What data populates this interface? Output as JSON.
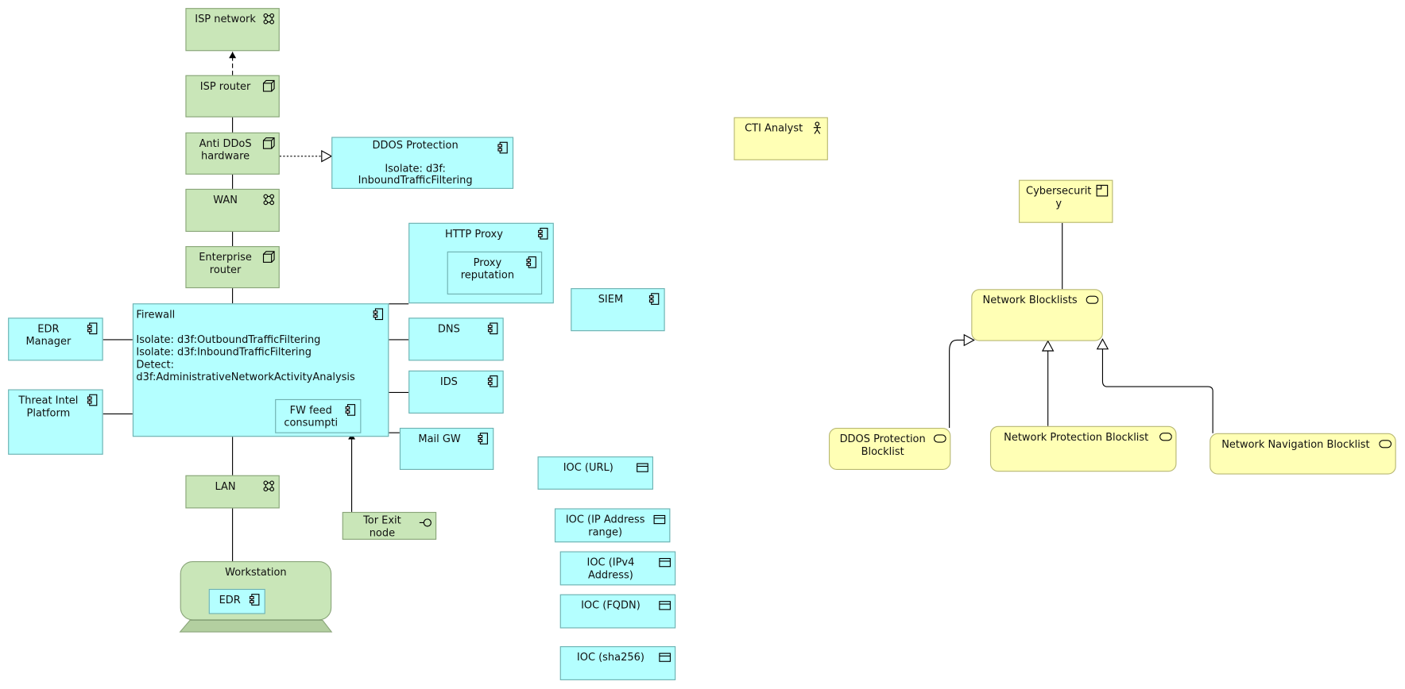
{
  "colors": {
    "technology": "#c9e6b8",
    "application": "#b4ffff",
    "business": "#ffffb5"
  },
  "nodes": {
    "isp_network": {
      "label": "ISP network",
      "icon": "network-icon"
    },
    "isp_router": {
      "label": "ISP router",
      "icon": "device-icon"
    },
    "anti_ddos": {
      "label": "Anti DDoS\nhardware",
      "icon": "device-icon"
    },
    "wan": {
      "label": "WAN",
      "icon": "network-icon"
    },
    "enterprise_router": {
      "label": "Enterprise\nrouter",
      "icon": "device-icon"
    },
    "ddos_protection": {
      "label": "DDOS Protection\n\nIsolate: d3f:\nInboundTrafficFiltering",
      "icon": "component-icon"
    },
    "http_proxy": {
      "label": "HTTP Proxy",
      "icon": "component-icon"
    },
    "proxy_reputation": {
      "label": "Proxy\nreputation",
      "icon": "component-icon"
    },
    "firewall": {
      "label": "Firewall\n\nIsolate: d3f:OutboundTrafficFiltering\nIsolate: d3f:InboundTrafficFiltering\nDetect: d3f:AdministrativeNetworkActivityAnalysis",
      "icon": "component-icon"
    },
    "fw_feed": {
      "label": "FW feed\nconsumpti",
      "icon": "component-icon"
    },
    "edr_manager": {
      "label": "EDR\nManager",
      "icon": "component-icon"
    },
    "threat_intel": {
      "label": "Threat Intel\nPlatform",
      "icon": "component-icon"
    },
    "dns": {
      "label": "DNS",
      "icon": "component-icon"
    },
    "ids": {
      "label": "IDS",
      "icon": "component-icon"
    },
    "mail_gw": {
      "label": "Mail GW",
      "icon": "component-icon"
    },
    "siem": {
      "label": "SIEM",
      "icon": "component-icon"
    },
    "lan": {
      "label": "LAN",
      "icon": "network-icon"
    },
    "tor_exit": {
      "label": "Tor Exit\nnode",
      "icon": "interface-icon"
    },
    "workstation": {
      "label": "Workstation"
    },
    "edr": {
      "label": "EDR",
      "icon": "component-icon"
    },
    "ioc_url": {
      "label": "IOC (URL)",
      "icon": "data-object-icon"
    },
    "ioc_ip_range": {
      "label": "IOC (IP Address\nrange)",
      "icon": "data-object-icon"
    },
    "ioc_ipv4": {
      "label": "IOC (IPv4\nAddress)",
      "icon": "data-object-icon"
    },
    "ioc_fqdn": {
      "label": "IOC (FQDN)",
      "icon": "data-object-icon"
    },
    "ioc_sha256": {
      "label": "IOC (sha256)",
      "icon": "data-object-icon"
    },
    "cti_analyst": {
      "label": "CTI Analyst",
      "icon": "actor-icon"
    },
    "cybersecurity": {
      "label": "Cybersecurit\ny",
      "icon": "product-icon"
    },
    "network_blocklists": {
      "label": "Network Blocklists",
      "icon": "service-icon"
    },
    "ddos_blocklist": {
      "label": "DDOS Protection\nBlocklist",
      "icon": "service-icon"
    },
    "net_protection_blocklist": {
      "label": "Network Protection Blocklist",
      "icon": "service-icon"
    },
    "net_navigation_blocklist": {
      "label": "Network Navigation Blocklist",
      "icon": "service-icon"
    }
  }
}
